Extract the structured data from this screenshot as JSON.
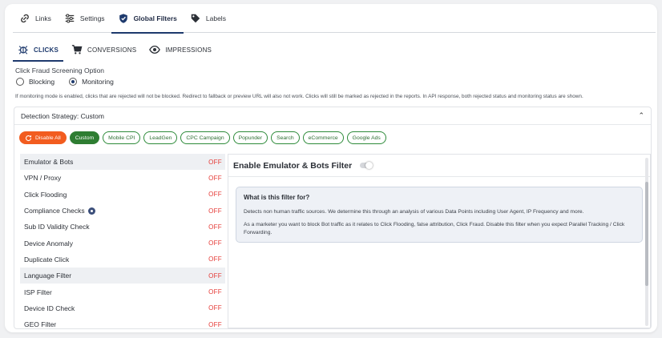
{
  "top_tabs": [
    {
      "label": "Links",
      "icon": "link-icon"
    },
    {
      "label": "Settings",
      "icon": "sliders-icon"
    },
    {
      "label": "Global Filters",
      "icon": "shield-check-icon",
      "active": true
    },
    {
      "label": "Labels",
      "icon": "tag-icon"
    }
  ],
  "sub_tabs": [
    {
      "label": "CLICKS",
      "icon": "bug-icon",
      "active": true
    },
    {
      "label": "CONVERSIONS",
      "icon": "cart-icon"
    },
    {
      "label": "IMPRESSIONS",
      "icon": "eye-icon"
    }
  ],
  "screening": {
    "title": "Click Fraud Screening Option",
    "blocking_label": "Blocking",
    "monitoring_label": "Monitoring",
    "selected": "Monitoring",
    "note": "If monitoring mode is enabled, clicks that are rejected will not be blocked. Redirect to fallback or preview URL will also not work. Clicks will still be marked as rejected in the reports. In API response, both rejected status and monitoring status are shown."
  },
  "strategy": {
    "title": "Detection Strategy: Custom",
    "chips": [
      "Disable All",
      "Custom",
      "Mobile CPI",
      "LeadGen",
      "CPC Campaign",
      "Popunder",
      "Search",
      "eCommerce",
      "Google Ads"
    ]
  },
  "filters": [
    {
      "label": "Emulator & Bots",
      "state": "OFF"
    },
    {
      "label": "VPN / Proxy",
      "state": "OFF"
    },
    {
      "label": "Click Flooding",
      "state": "OFF"
    },
    {
      "label": "Compliance Checks",
      "state": "OFF"
    },
    {
      "label": "Sub ID Validity Check",
      "state": "OFF"
    },
    {
      "label": "Device Anomaly",
      "state": "OFF"
    },
    {
      "label": "Duplicate Click",
      "state": "OFF"
    },
    {
      "label": "Language Filter",
      "state": "OFF"
    },
    {
      "label": "ISP Filter",
      "state": "OFF"
    },
    {
      "label": "Device ID Check",
      "state": "OFF"
    },
    {
      "label": "GEO Filter",
      "state": "OFF"
    }
  ],
  "detail": {
    "title": "Enable Emulator & Bots Filter",
    "info_title": "What is this filter for?",
    "p1": "Detects non human traffic sources. We determine this through an analysis of various Data Points including User Agent, IP Frequency and more.",
    "p2": "As a marketer you want to block Bot traffic as it relates to Click Flooding, false attribution, Click Fraud. Disable this filter when you expect Parallel Tracking / Click Forwarding."
  },
  "colors": {
    "accent": "#1e3a6d",
    "off": "#e53935",
    "disable": "#f25c1f",
    "custom": "#2e7d32"
  }
}
